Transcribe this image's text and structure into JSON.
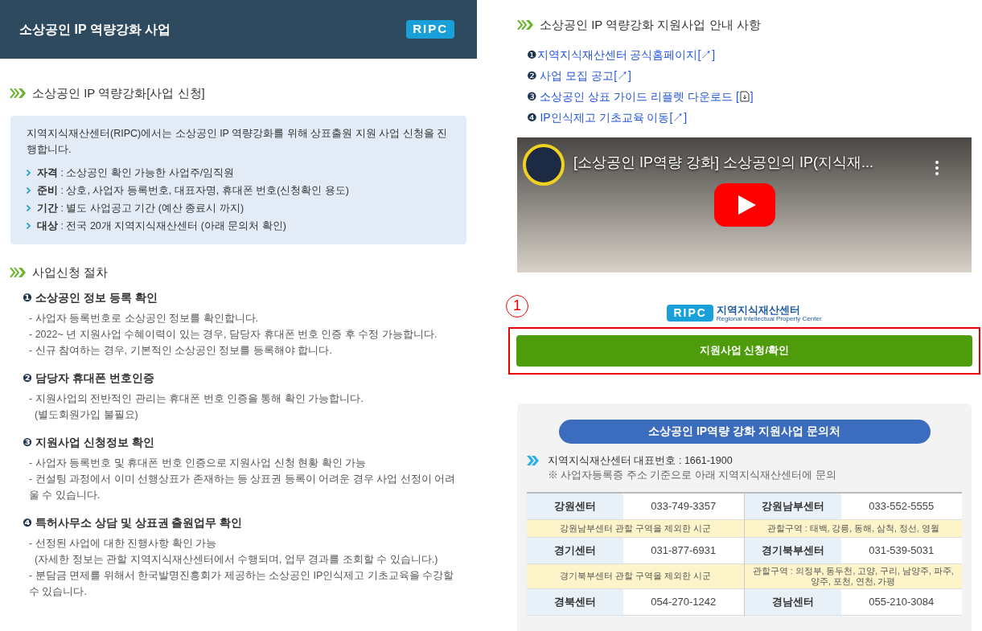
{
  "header": {
    "title": "소상공인 IP 역량강화 사업",
    "logo": "RIPC"
  },
  "apply_section": {
    "title": "소상공인 IP 역량강화[사업 신청]",
    "intro": "지역지식재산센터(RIPC)에서는 소상공인 IP 역량강화를 위해 상표출원 지원 사업 신청을 진행합니다.",
    "items": [
      {
        "label": "자격",
        "text": " : 소상공인 확인 가능한 사업주/임직원"
      },
      {
        "label": "준비",
        "text": " : 상호, 사업자 등록번호, 대표자명, 휴대폰 번호(신청확인 용도)"
      },
      {
        "label": "기간",
        "text": " : 별도 사업공고 기간 (예산 종료시 까지)"
      },
      {
        "label": "대상",
        "text": " : 전국 20개 지역지식재산센터 (아래 문의처 확인)"
      }
    ]
  },
  "procedure": {
    "title": "사업신청 절차",
    "steps": [
      {
        "number": "❶",
        "title": "소상공인 정보 등록 확인",
        "lines": [
          "- 사업자 등록번호로 소상공인 정보를 확인합니다.",
          "- 2022~ 년 지원사업 수혜이력이 있는 경우, 담당자 휴대폰 번호 인증 후 수정 가능합니다.",
          "- 신규 참여하는 경우, 기본적인 소상공인 정보를 등록해야 합니다."
        ]
      },
      {
        "number": "❷",
        "title": "담당자 휴대폰 번호인증",
        "lines": [
          "- 지원사업의 전반적인 관리는 휴대폰 번호 인증을 통해 확인 가능합니다.",
          "  (별도회원가입 불필요)"
        ]
      },
      {
        "number": "❸",
        "title": "지원사업 신청정보 확인",
        "lines": [
          "- 사업자 등록번호 및 휴대폰 번호 인증으로 지원사업 신청 현황 확인 가능",
          "- 컨설팅 과정에서 이미 선행상표가 존재하는 등 상표권 등록이 어려운 경우 사업 선정이 어려울 수 있습니다."
        ]
      },
      {
        "number": "❹",
        "title": "특허사무소 상담 및 상표권 출원업무 확인",
        "lines": [
          "- 선정된 사업에 대한 진행사항 확인 가능",
          "  (자세한 정보는 관할 지역지식재산센터에서 수행되며, 업무 경과를 조회할 수 있습니다.)",
          "- 분담금 면제를 위해서 한국발명진흥회가 제공하는 소상공인 IP인식제고 기초교육을 수강할 수 있습니다."
        ]
      }
    ]
  },
  "guide": {
    "title": "소상공인 IP 역량강화 지원사업 안내 사항",
    "links": [
      {
        "number": "❶",
        "text": "지역지식재산센터 공식홈페이지[↗]",
        "kind": "external"
      },
      {
        "number": "❷",
        "text": " 사업 모집 공고[↗]",
        "kind": "external"
      },
      {
        "number": "❸",
        "text": " 소상공인 상표 가이드 리플렛 다운로드 [",
        "after": "]",
        "kind": "download"
      },
      {
        "number": "❹",
        "text": " IP인식제고 기초교육 이동[↗]",
        "kind": "external"
      }
    ]
  },
  "video": {
    "title": "[소상공인 IP역량 강화] 소상공인의 IP(지식재..."
  },
  "annotation": "1",
  "ripc_logo": {
    "mark": "RIPC",
    "name": "지역지식재산센터",
    "subtitle": "Regional Intellectual Property Center"
  },
  "apply_button": "지원사업 신청/확인",
  "contact": {
    "title": "소상공인 IP역량 강화 지원사업 문의처",
    "rep_line": "지역지식재산센터 대표번호 : 1661-1900",
    "note": "※ 사업자등록증 주소 기준으로 아래 지역지식재산센터에 문의",
    "rows": [
      {
        "cells": [
          {
            "name": "강원센터",
            "phone": "033-749-3357",
            "area": "강원남부센터 관할 구역을 제외한 시군"
          },
          {
            "name": "강원남부센터",
            "phone": "033-552-5555",
            "area": "관할구역 : 태백, 강릉, 동해, 삼척, 정선, 영월"
          }
        ]
      },
      {
        "cells": [
          {
            "name": "경기센터",
            "phone": "031-877-6931",
            "area": "경기북부센터 관할 구역을 제외한 시군"
          },
          {
            "name": "경기북부센터",
            "phone": "031-539-5031",
            "area": "관할구역 : 의정부, 동두천, 고양, 구리, 남양주, 파주, 양주, 포천, 연천, 가평"
          }
        ]
      },
      {
        "cells": [
          {
            "name": "경북센터",
            "phone": "054-270-1242"
          },
          {
            "name": "경남센터",
            "phone": "055-210-3084"
          }
        ]
      }
    ]
  }
}
